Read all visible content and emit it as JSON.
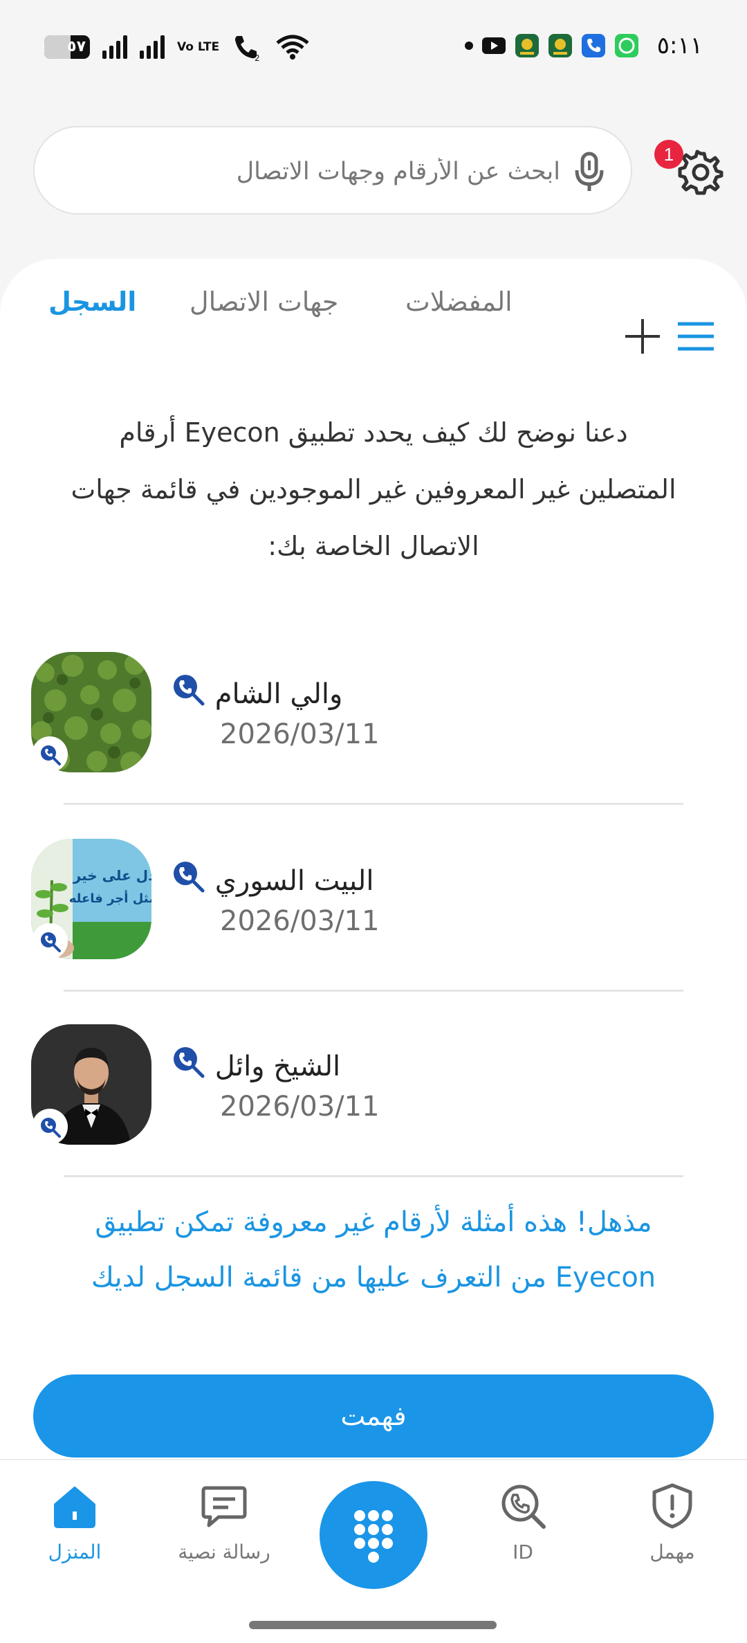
{
  "status_bar": {
    "battery": "٥٧",
    "battery_level": 0.57,
    "volte": "Vo LTE",
    "time": "٥:١١",
    "notification_icons": [
      "dot-icon",
      "youtube-icon",
      "app-icon",
      "app-icon",
      "phone-app-icon",
      "whatsapp-icon"
    ]
  },
  "search": {
    "placeholder": "ابحث عن الأرقام وجهات الاتصال",
    "notification_badge": "1"
  },
  "tabs": [
    {
      "label": "السجل",
      "active": true
    },
    {
      "label": "جهات الاتصال",
      "active": false
    },
    {
      "label": "المفضلات",
      "active": false
    }
  ],
  "intro_text": "دعنا نوضح لك كيف يحدد تطبيق Eyecon أرقام المتصلين غير المعروفين غير الموجودين في قائمة جهات الاتصال الخاصة بك:",
  "contacts": [
    {
      "name": "والي الشام",
      "date": "2026/03/11"
    },
    {
      "name": "البيت السوري",
      "date": "2026/03/11"
    },
    {
      "name": "الشيخ وائل",
      "date": "2026/03/11"
    }
  ],
  "outro_text": "مذهل! هذه أمثلة لأرقام غير معروفة تمكن تطبيق Eyecon من التعرف عليها من قائمة السجل لديك",
  "got_it_button": "فهمت",
  "avatar_texts": {
    "contact_2_line1": "دل على خير",
    "contact_2_line2": "مثل أجر فاعله"
  },
  "bottom_nav": {
    "home": "المنزل",
    "messages": "رسالة نصية",
    "id": "ID",
    "spam": "مهمل"
  },
  "colors": {
    "accent": "#1a95e8",
    "badge": "#e8243f",
    "icon_dark_blue": "#1f4fa8"
  }
}
